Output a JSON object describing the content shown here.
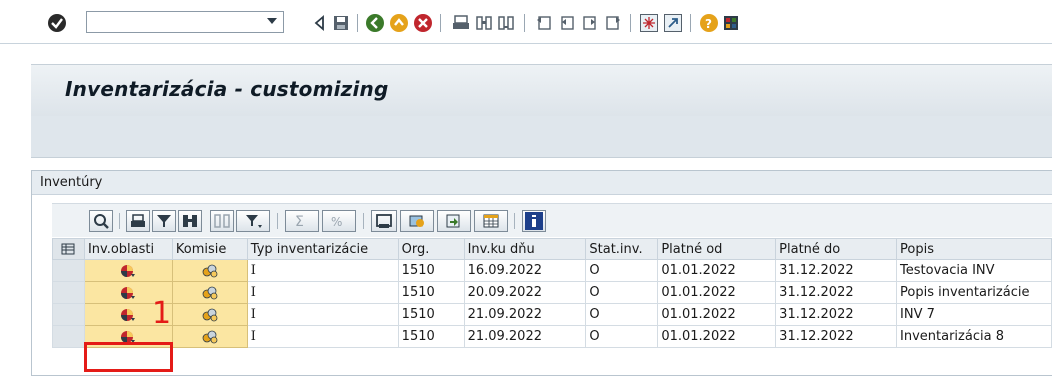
{
  "toolbar": {
    "command_field_value": "",
    "command_field_placeholder": "",
    "icons": [
      "enter-icon",
      "back-icon",
      "save-icon",
      "back-nav-icon",
      "exit-icon",
      "cancel-icon",
      "print-icon",
      "find-icon",
      "find-next-icon",
      "first-page-icon",
      "prev-page-icon",
      "next-page-icon",
      "last-page-icon",
      "new-session-icon",
      "shortcut-icon",
      "help-icon",
      "layout-icon"
    ]
  },
  "title": "Inventarizácia - customizing",
  "group": {
    "title": "Inventúry"
  },
  "alv_toolbar": {
    "icons": [
      "details-icon",
      "print-icon",
      "filter-icon",
      "find-icon",
      "find-next-icon",
      "filter-set-icon",
      "sum-icon",
      "subtotal-icon",
      "print-preview-icon",
      "export-icon",
      "spreadsheet-icon",
      "layout-icon",
      "info-icon"
    ]
  },
  "grid": {
    "columns": [
      "Inv.oblasti",
      "Komisie",
      "Typ inventarizácie",
      "Org.",
      "Inv.ku dňu",
      "Stat.inv.",
      "Platné od",
      "Platné do",
      "Popis"
    ],
    "rows": [
      {
        "typ": "I",
        "org": "1510",
        "inv_ku_dnu": "16.09.2022",
        "stat": "O",
        "od": "01.01.2022",
        "do": "31.12.2022",
        "popis": "Testovacia INV"
      },
      {
        "typ": "I",
        "org": "1510",
        "inv_ku_dnu": "20.09.2022",
        "stat": "O",
        "od": "01.01.2022",
        "do": "31.12.2022",
        "popis": "Popis inventarizácie"
      },
      {
        "typ": "I",
        "org": "1510",
        "inv_ku_dnu": "21.09.2022",
        "stat": "O",
        "od": "01.01.2022",
        "do": "31.12.2022",
        "popis": "INV 7"
      },
      {
        "typ": "I",
        "org": "1510",
        "inv_ku_dnu": "21.09.2022",
        "stat": "O",
        "od": "01.01.2022",
        "do": "31.12.2022",
        "popis": "Inventarizácia 8"
      }
    ]
  },
  "annotation": {
    "number": "1",
    "color": "#e41b17"
  },
  "colors": {
    "button_cell": "#fbe6a2",
    "title_bar": "#dde4ea",
    "header": "#e8edf1"
  }
}
